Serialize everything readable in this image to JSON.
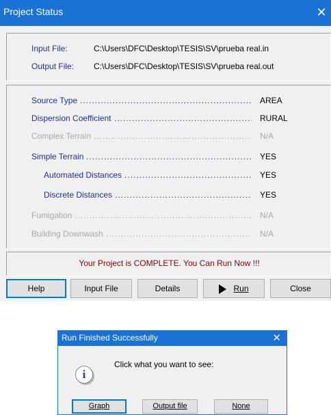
{
  "project_status": {
    "title": "Project Status",
    "close_glyph": "✕",
    "input_file": {
      "label": "Input File:",
      "value": "C:\\Users\\DFC\\Desktop\\TESIS\\SV\\prueba real.in"
    },
    "output_file": {
      "label": "Output File:",
      "value": "C:\\Users\\DFC\\Desktop\\TESIS\\SV\\prueba real.out"
    },
    "params": [
      {
        "label": "Source Type",
        "value": "AREA",
        "enabled": true,
        "indent": false
      },
      {
        "label": "Dispersion Coefficient",
        "value": "RURAL",
        "enabled": true,
        "indent": false
      },
      {
        "label": "Complex Terrain",
        "value": "N/A",
        "enabled": false,
        "indent": false
      },
      {
        "label": "Simple Terrain",
        "value": "YES",
        "enabled": true,
        "indent": false
      },
      {
        "label": "Automated Distances",
        "value": "YES",
        "enabled": true,
        "indent": true
      },
      {
        "label": "Discrete Distances",
        "value": "YES",
        "enabled": true,
        "indent": true
      },
      {
        "label": "Fumigation",
        "value": "N/A",
        "enabled": false,
        "indent": false
      },
      {
        "label": "Building Downwash",
        "value": "N/A",
        "enabled": false,
        "indent": false
      }
    ],
    "status_message": "Your Project is COMPLETE.  You Can Run Now !!!",
    "buttons": {
      "help": "Help",
      "input_file": "Input File",
      "details": "Details",
      "run": "Run",
      "close": "Close"
    }
  },
  "run_finished": {
    "title": "Run Finished Successfully",
    "close_glyph": "✕",
    "icon": "information-icon",
    "icon_glyph": "i",
    "prompt": "Click what you want to see:",
    "buttons": {
      "graph": "Graph",
      "output_file": "Output file",
      "none": "None"
    }
  },
  "colors": {
    "title_bar": "#1a73d4",
    "label_blue": "#1f2f9a",
    "status_red": "#8b0000",
    "disabled": "#a8a8a8"
  }
}
